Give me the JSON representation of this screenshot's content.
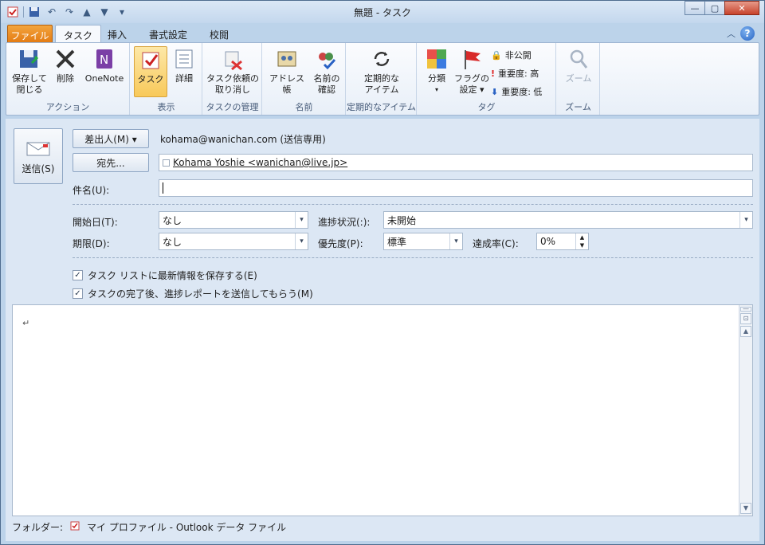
{
  "window": {
    "title": "無題 - タスク"
  },
  "tabs": [
    {
      "label": "ファイル"
    },
    {
      "label": "タスク"
    },
    {
      "label": "挿入"
    },
    {
      "label": "書式設定"
    },
    {
      "label": "校閲"
    }
  ],
  "ribbon": {
    "groups": [
      {
        "label": "アクション",
        "buttons": [
          "保存して\n閉じる",
          "削除",
          "OneNote"
        ]
      },
      {
        "label": "表示",
        "buttons": [
          "タスク",
          "詳細"
        ]
      },
      {
        "label": "タスクの管理",
        "buttons": [
          "タスク依頼の\n取り消し"
        ]
      },
      {
        "label": "名前",
        "buttons": [
          "アドレス帳",
          "名前の\n確認"
        ]
      },
      {
        "label": "定期的なアイテム",
        "buttons": [
          "定期的な\nアイテム"
        ]
      },
      {
        "label": "タグ",
        "buttons": [
          "分類",
          "フラグの\n設定 ▾"
        ],
        "small": [
          "非公開",
          "重要度: 高",
          "重要度: 低"
        ]
      },
      {
        "label": "ズーム",
        "buttons": [
          "ズーム"
        ]
      }
    ]
  },
  "form": {
    "send_label": "送信(S)",
    "from_button": "差出人(M) ▾",
    "from_value": "kohama@wanichan.com (送信専用)",
    "to_button": "宛先...",
    "to_value": "Kohama Yoshie <wanichan@live.jp>",
    "subject_label": "件名(U):",
    "subject_value": "",
    "start_label": "開始日(T):",
    "start_value": "なし",
    "due_label": "期限(D):",
    "due_value": "なし",
    "status_label": "進捗状況(:):",
    "status_value": "未開始",
    "priority_label": "優先度(P):",
    "priority_value": "標準",
    "percent_label": "達成率(C):",
    "percent_value": "0%",
    "check1": "タスク リストに最新情報を保存する(E)",
    "check2": "タスクの完了後、進捗レポートを送信してもらう(M)",
    "body_mark": "↵"
  },
  "footer": {
    "label": "フォルダー:",
    "value": "マイ プロファイル - Outlook データ ファイル"
  }
}
